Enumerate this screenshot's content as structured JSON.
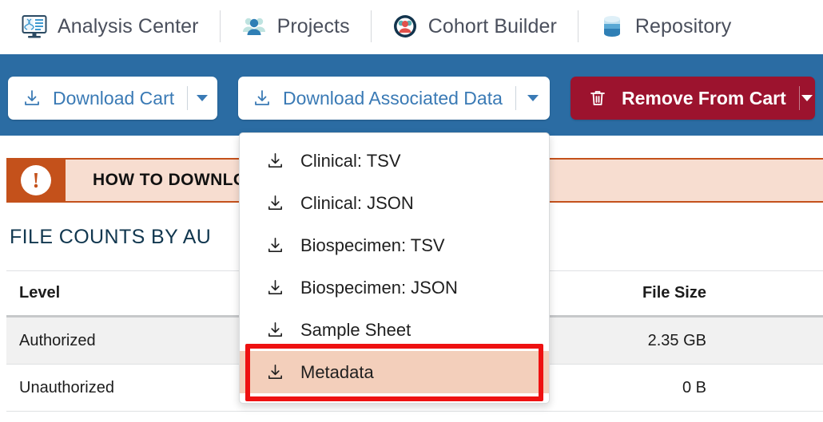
{
  "nav": {
    "items": [
      {
        "label": "Analysis Center",
        "icon": "analysis-center-icon"
      },
      {
        "label": "Projects",
        "icon": "projects-icon"
      },
      {
        "label": "Cohort Builder",
        "icon": "cohort-builder-icon"
      },
      {
        "label": "Repository",
        "icon": "repository-icon"
      }
    ]
  },
  "toolbar": {
    "download_cart_label": "Download Cart",
    "download_assoc_label": "Download Associated Data",
    "remove_label": "Remove From Cart",
    "bar_color": "#2b6ca3",
    "remove_color": "#9c132e",
    "link_color": "#3a7ab5"
  },
  "alert": {
    "icon": "exclamation-icon",
    "text": "HOW TO DOWNLO",
    "accent_color": "#c4511b",
    "background_color": "#f7ddd0"
  },
  "section": {
    "title": "FILE COUNTS BY AU",
    "title_color": "#11374f"
  },
  "table": {
    "columns": [
      "Level",
      "File Size"
    ],
    "rows": [
      {
        "level": "Authorized",
        "file_size": "2.35 GB"
      },
      {
        "level": "Unauthorized",
        "file_size": "0 B"
      }
    ]
  },
  "menu": {
    "items": [
      {
        "label": "Clinical: TSV",
        "icon": "download-icon",
        "active": false
      },
      {
        "label": "Clinical: JSON",
        "icon": "download-icon",
        "active": false
      },
      {
        "label": "Biospecimen: TSV",
        "icon": "download-icon",
        "active": false
      },
      {
        "label": "Biospecimen: JSON",
        "icon": "download-icon",
        "active": false
      },
      {
        "label": "Sample Sheet",
        "icon": "download-icon",
        "active": false
      },
      {
        "label": "Metadata",
        "icon": "download-icon",
        "active": true
      }
    ]
  },
  "highlight": {
    "color": "#ee1111"
  }
}
